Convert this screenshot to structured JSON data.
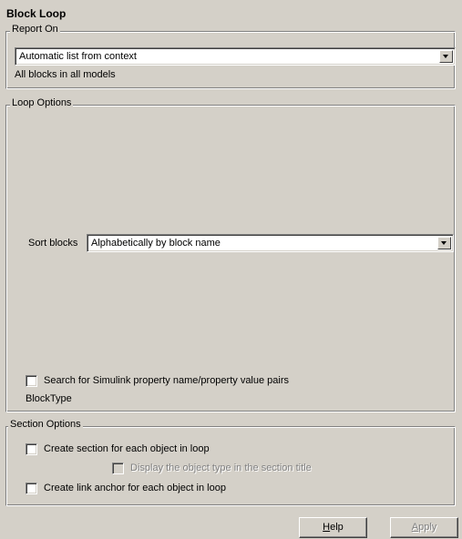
{
  "title": "Block Loop",
  "report_on": {
    "legend": "Report On",
    "selected": "Automatic list from context",
    "description": "All blocks in all models"
  },
  "loop_options": {
    "legend": "Loop Options",
    "sort_label": "Sort blocks",
    "sort_selected": "Alphabetically by block name",
    "search_checkbox_label": "Search for Simulink property name/property value pairs",
    "search_checked": false,
    "property_text": "BlockType"
  },
  "section_options": {
    "legend": "Section Options",
    "create_section_label": "Create section for each object in loop",
    "create_section_checked": false,
    "display_type_label": "Display the object type in the section title",
    "display_type_checked": false,
    "create_anchor_label": "Create link anchor for each object in loop",
    "create_anchor_checked": false
  },
  "buttons": {
    "help": {
      "mnemonic": "H",
      "rest": "elp"
    },
    "apply": {
      "mnemonic": "A",
      "rest": "pply"
    }
  },
  "colors": {
    "background": "#d4d0c8",
    "field": "#ffffff",
    "disabled_text": "#808080"
  }
}
